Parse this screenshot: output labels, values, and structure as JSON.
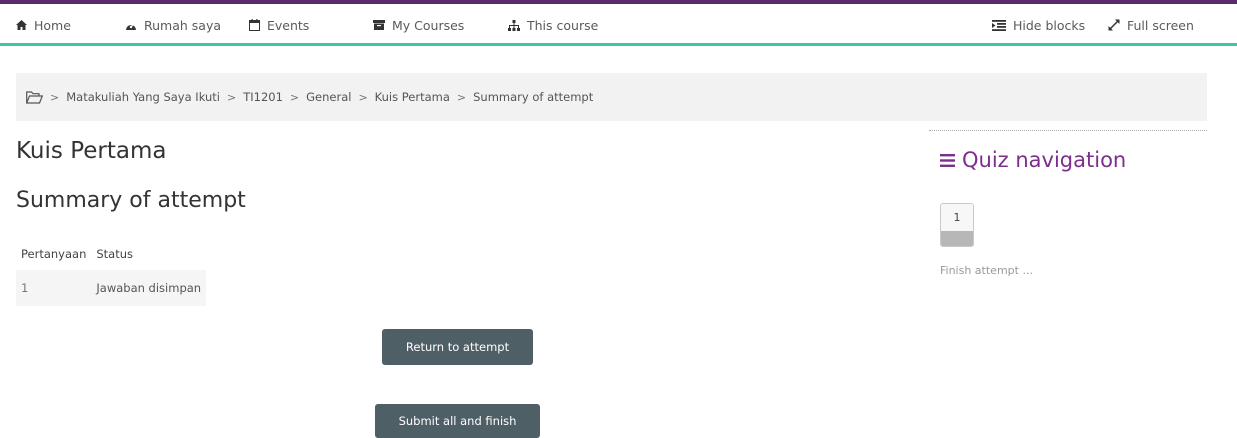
{
  "navbar": {
    "items": [
      {
        "label": "Home",
        "icon": "home-icon"
      },
      {
        "label": "Rumah saya",
        "icon": "dashboard-icon"
      },
      {
        "label": "Events",
        "icon": "calendar-icon"
      },
      {
        "label": "My Courses",
        "icon": "archive-icon"
      },
      {
        "label": "This course",
        "icon": "sitemap-icon"
      }
    ],
    "hide_blocks": "Hide blocks",
    "full_screen": "Full screen",
    "accent_color": "#3cc5a8",
    "top_color": "#5b2a6e"
  },
  "breadcrumb": {
    "icon": "folder-open-icon",
    "separator": ">",
    "items": [
      "Matakuliah Yang Saya Ikuti",
      "TI1201",
      "General",
      "Kuis Pertama",
      "Summary of attempt"
    ]
  },
  "main": {
    "page_title": "Kuis Pertama",
    "section_title": "Summary of attempt",
    "table": {
      "headers": [
        "Pertanyaan",
        "Status"
      ],
      "rows": [
        {
          "question": "1",
          "status": "Jawaban disimpan"
        }
      ]
    },
    "return_button": "Return to attempt",
    "submit_button": "Submit all and finish",
    "button_color": "#4e5f66"
  },
  "quiz_nav": {
    "title": "Quiz navigation",
    "title_color": "#7d2e8c",
    "questions": [
      "1"
    ],
    "finish_link": "Finish attempt ..."
  }
}
